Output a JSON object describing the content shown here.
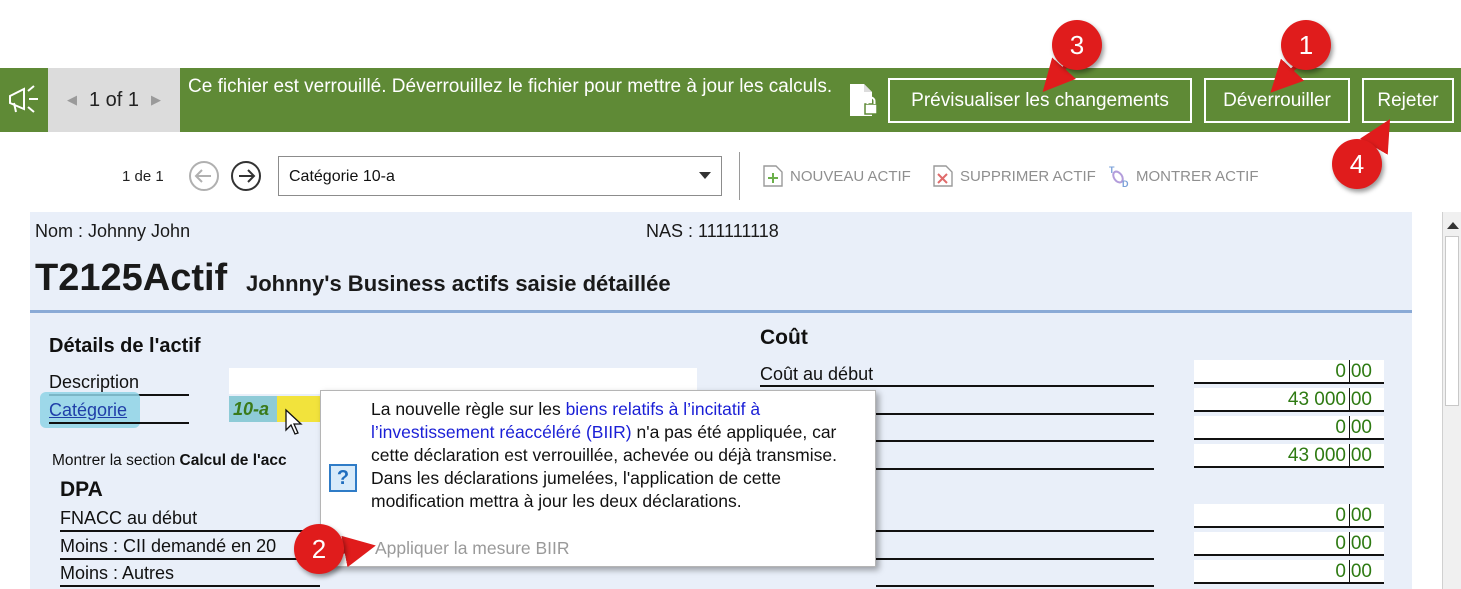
{
  "banner": {
    "pager_text": "1 of 1",
    "message": "Ce fichier est verrouillé. Déverrouillez le fichier pour mettre à jour les calculs.",
    "btn_preview": "Prévisualiser les changements",
    "btn_unlock": "Déverrouiller",
    "btn_reject": "Rejeter",
    "color": "#5f8a36"
  },
  "toolbar": {
    "record_index": "1 de 1",
    "category_value": "Catégorie 10-a",
    "new_asset": "NOUVEAU ACTIF",
    "delete_asset": "SUPPRIMER ACTIF",
    "show_asset": "MONTRER ACTIF"
  },
  "form": {
    "nom": "Nom : Johnny John",
    "nas": "NAS : 111111118",
    "code": "T2125Actif",
    "title": "Johnny's Business actifs saisie détaillée",
    "details_heading": "Détails de l'actif",
    "description_label": "Description",
    "category_label": "Catégorie",
    "category_value": "10-a",
    "show_section_prefix": "Montrer la section ",
    "show_section_bold": "Calcul de l'acc",
    "dpa_heading": "DPA",
    "fnacc_label": "FNACC au début",
    "cii_label": "Moins : CII demandé en 20",
    "autres_label": "Moins : Autres",
    "cout_heading": "Coût",
    "cout_debut_label": "Coût au début",
    "amounts": [
      {
        "int": "0",
        "dec": "00"
      },
      {
        "int": "43 000",
        "dec": "00"
      },
      {
        "int": "0",
        "dec": "00"
      },
      {
        "int": "43 000",
        "dec": "00"
      },
      {
        "int": "0",
        "dec": "00"
      },
      {
        "int": "0",
        "dec": "00"
      },
      {
        "int": "0",
        "dec": "00"
      }
    ]
  },
  "tooltip": {
    "help_glyph": "?",
    "text_1": "La nouvelle règle sur les ",
    "link_text": "biens relatifs à l’incitatif à l’investissement réaccéléré (BIIR)",
    "text_2": " n'a pas été appliquée, car cette déclaration est verrouillée, achevée ou déjà transmise.  Dans les déclarations jumelées, l'application de cette modification mettra à jour les deux déclarations.",
    "apply_link": "Appliquer la mesure BIIR"
  },
  "callouts": [
    "1",
    "2",
    "3",
    "4"
  ]
}
